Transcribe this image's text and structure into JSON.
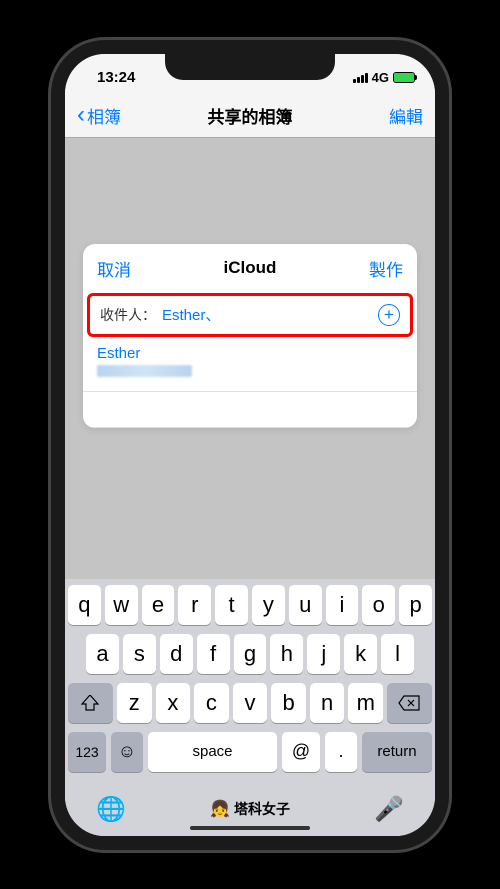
{
  "status": {
    "time": "13:24",
    "network": "4G"
  },
  "nav": {
    "back": "相簿",
    "title": "共享的相簿",
    "edit": "編輯"
  },
  "sheet": {
    "cancel": "取消",
    "title": "iCloud",
    "create": "製作",
    "recipients_label": "收件人：",
    "recipients_value": "Esther、",
    "suggestion_name": "Esther"
  },
  "keyboard": {
    "row1": [
      "q",
      "w",
      "e",
      "r",
      "t",
      "y",
      "u",
      "i",
      "o",
      "p"
    ],
    "row2": [
      "a",
      "s",
      "d",
      "f",
      "g",
      "h",
      "j",
      "k",
      "l"
    ],
    "row3": [
      "z",
      "x",
      "c",
      "v",
      "b",
      "n",
      "m"
    ],
    "n123": "123",
    "space": "space",
    "at": "@",
    "dot": ".",
    "return": "return"
  },
  "watermark": "塔科女子"
}
